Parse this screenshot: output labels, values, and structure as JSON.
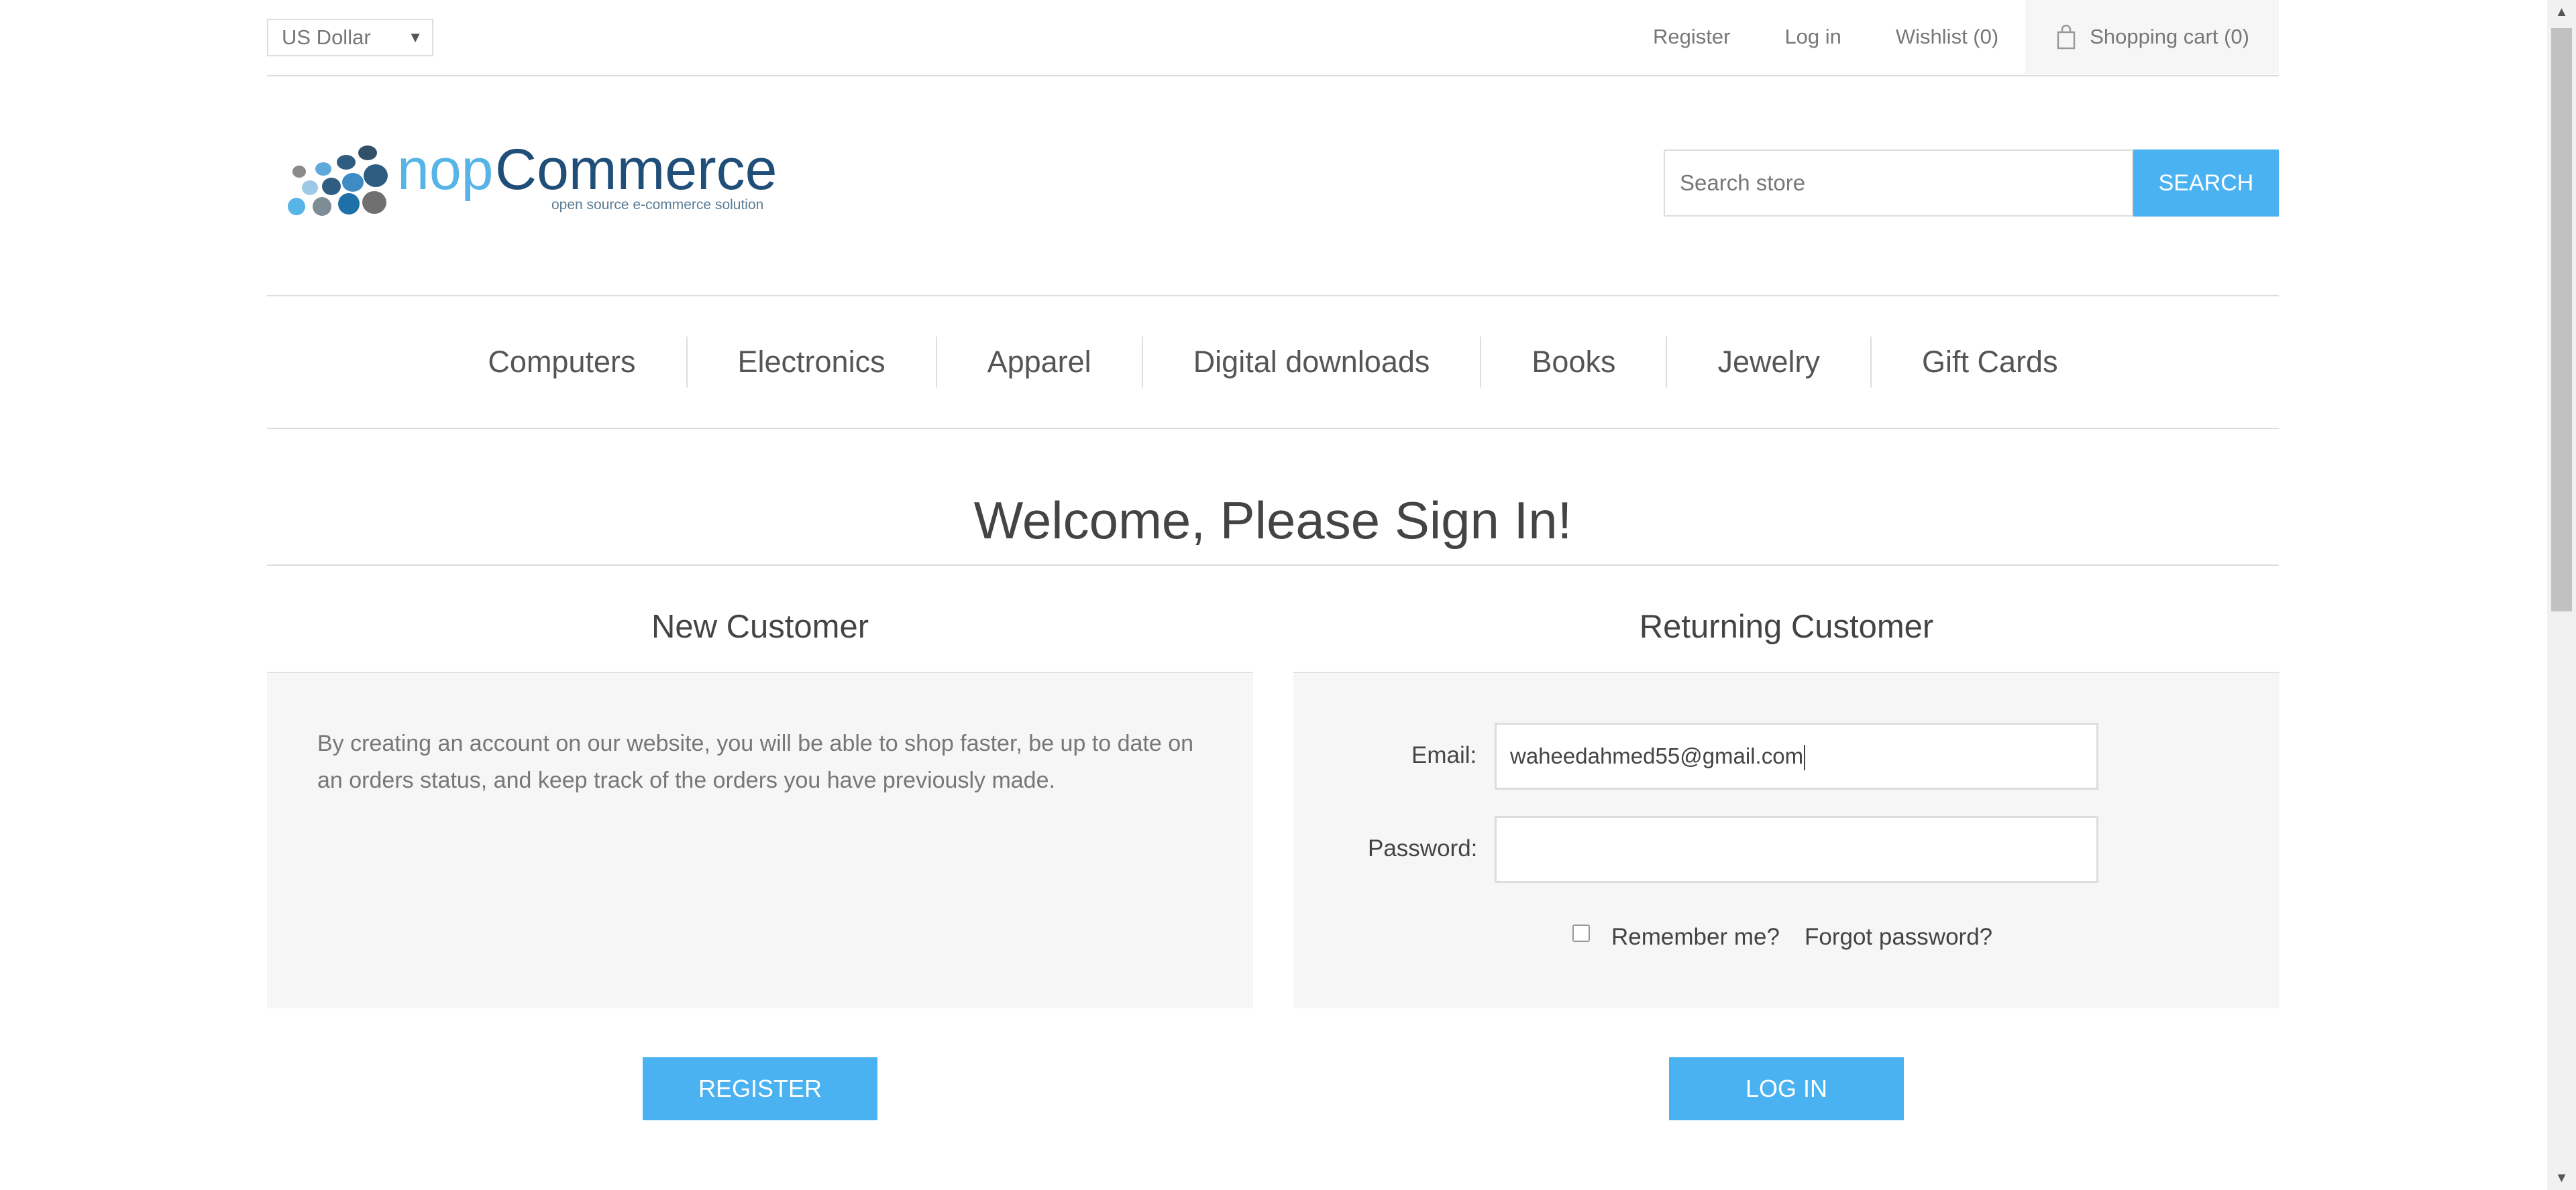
{
  "header": {
    "currency_selected": "US Dollar",
    "links": {
      "register": "Register",
      "login": "Log in",
      "wishlist": "Wishlist (0)",
      "cart": "Shopping cart (0)"
    }
  },
  "logo": {
    "brand_nop": "nop",
    "brand_commerce": "Commerce",
    "tagline": "open source e-commerce solution"
  },
  "search": {
    "placeholder": "Search store",
    "button_label": "SEARCH"
  },
  "menu": [
    "Computers",
    "Electronics",
    "Apparel",
    "Digital downloads",
    "Books",
    "Jewelry",
    "Gift Cards"
  ],
  "page_title": "Welcome, Please Sign In!",
  "new_customer": {
    "title": "New Customer",
    "text": "By creating an account on our website, you will be able to shop faster, be up to date on an orders status, and keep track of the orders you have previously made.",
    "button_label": "REGISTER"
  },
  "returning_customer": {
    "title": "Returning Customer",
    "email_label": "Email:",
    "email_value": "waheedahmed55@gmail.com",
    "password_label": "Password:",
    "remember_label": "Remember me?",
    "forgot_label": "Forgot password?",
    "button_label": "LOG IN"
  },
  "colors": {
    "accent": "#4ab2f1",
    "logo_blue": "#1f6fa8",
    "logo_light": "#56b4e6"
  }
}
